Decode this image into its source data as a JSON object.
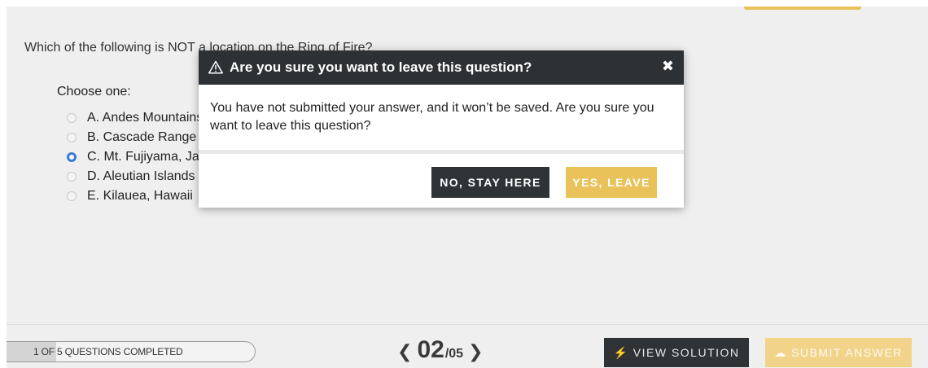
{
  "question": {
    "text": "Which of the following is NOT a location on the Ring of Fire?",
    "choose_label": "Choose one:",
    "choices": [
      {
        "label": "A. Andes Mountains",
        "selected": false
      },
      {
        "label": "B. Cascade Range",
        "selected": false
      },
      {
        "label": "C. Mt. Fujiyama, Japan",
        "selected": true
      },
      {
        "label": "D. Aleutian Islands",
        "selected": false
      },
      {
        "label": "E. Kilauea, Hawaii",
        "selected": false
      }
    ]
  },
  "modal": {
    "title": "Are you sure you want to leave this question?",
    "message": "You have not submitted your answer, and it won’t be saved. Are you sure you want to leave this question?",
    "close_glyph": "✖",
    "stay_label": "NO, STAY HERE",
    "leave_label": "YES, LEAVE"
  },
  "footer": {
    "progress_text": "1 OF 5 QUESTIONS COMPLETED",
    "progress_fraction": 0.2,
    "prev_glyph": "❮",
    "next_glyph": "❯",
    "current_page": "02",
    "total_pages": "/05",
    "view_solution_label": "⚡ VIEW SOLUTION",
    "submit_label": "☁ SUBMIT ANSWER"
  },
  "colors": {
    "accent_yellow": "#e9c25a",
    "dark": "#2f3336",
    "radio_selected": "#3a7bd5"
  },
  "icons": {
    "warning": "warning-triangle-icon",
    "close": "close-icon",
    "prev": "chevron-left-icon",
    "next": "chevron-right-icon",
    "view_solution": "lightning-icon",
    "submit": "cloud-upload-icon"
  }
}
